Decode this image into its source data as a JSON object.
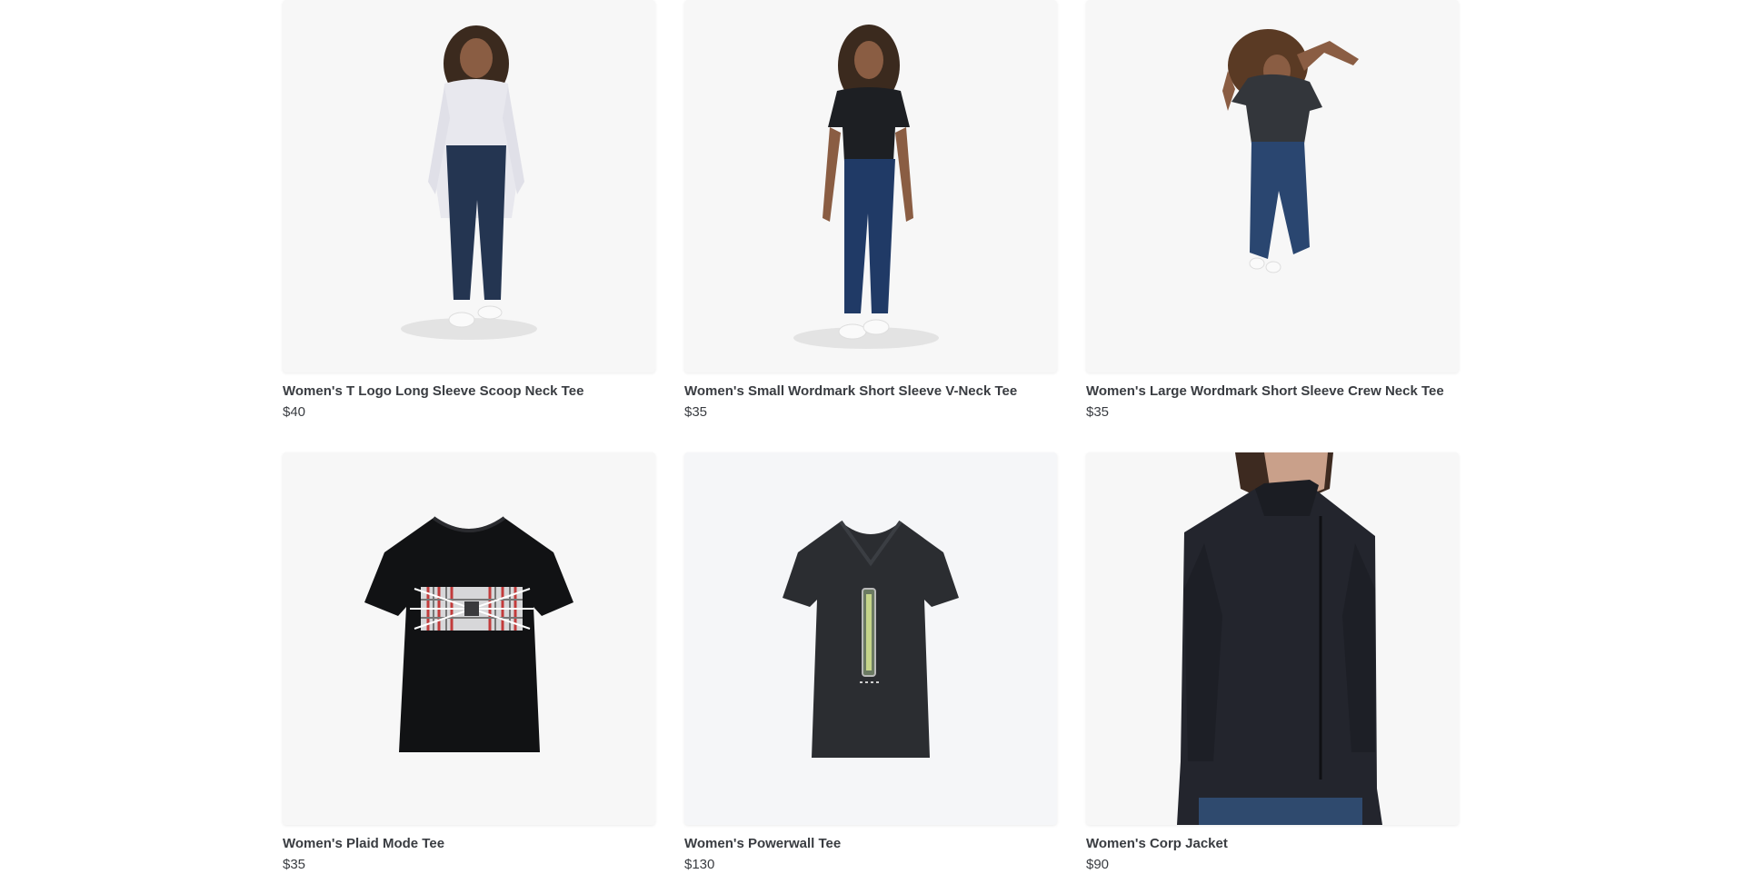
{
  "products": [
    {
      "name": "Women's T Logo Long Sleeve Scoop Neck Tee",
      "price": "$40",
      "image": "model-white-long-sleeve-jeans"
    },
    {
      "name": "Women's Small Wordmark Short Sleeve V-Neck Tee",
      "price": "$35",
      "image": "model-black-vneck-jeans"
    },
    {
      "name": "Women's Large Wordmark Short Sleeve Crew Neck Tee",
      "price": "$35",
      "image": "model-jumping-black-tee"
    },
    {
      "name": "Women's Plaid Mode Tee",
      "price": "$35",
      "image": "black-tee-plaid-graphic"
    },
    {
      "name": "Women's Powerwall Tee",
      "price": "$130",
      "image": "dark-gray-tee-powerwall-graphic"
    },
    {
      "name": "Women's Corp Jacket",
      "price": "$90",
      "image": "model-black-softshell-jacket"
    }
  ]
}
